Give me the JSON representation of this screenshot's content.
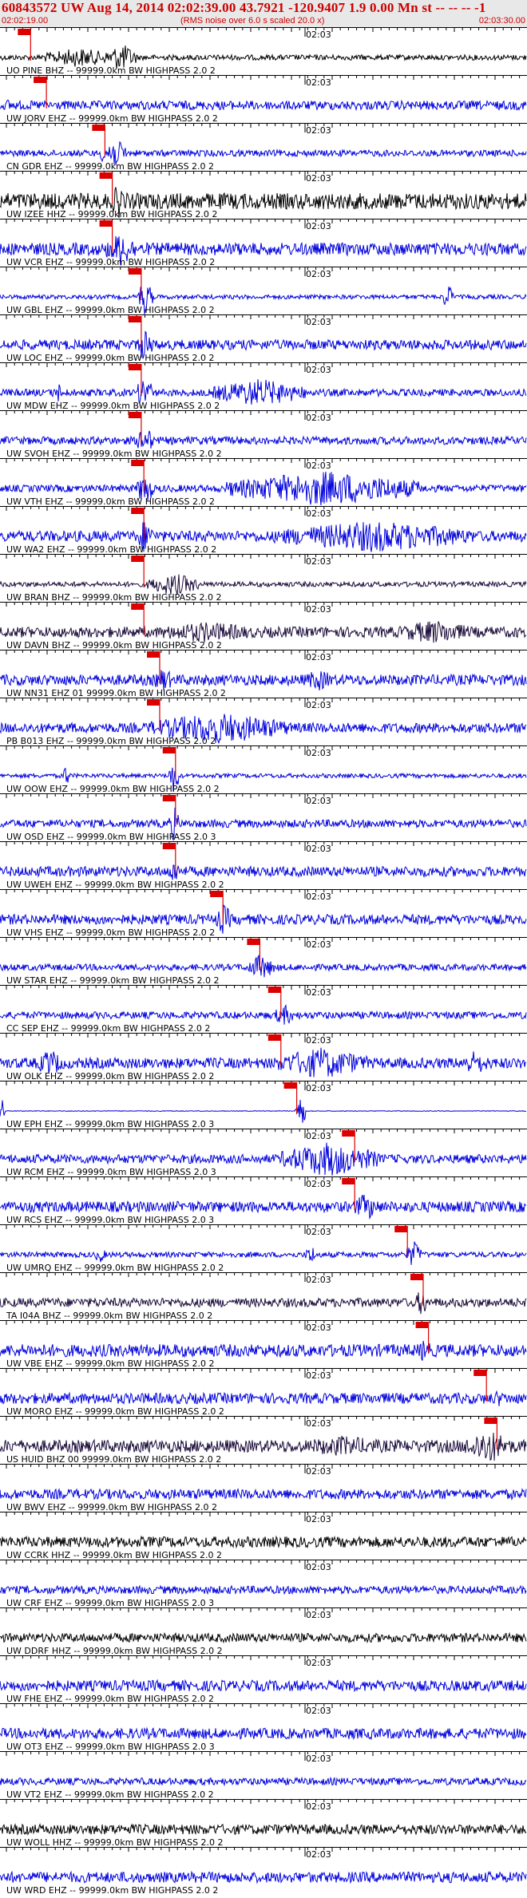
{
  "header": {
    "title": "60843572 UW Aug 14, 2014 02:02:39.00   43.7921 -120.9407  1.9 0.00 Mn st -- -- --  -1",
    "start_time": "02:02:19.00",
    "noise_note": "(RMS noise over 6.0 s scaled 20.0 x)",
    "end_time": "02:03:30.00"
  },
  "minute_label": "02:03",
  "colors": {
    "header_text": "#cc0000",
    "header_bg": "#e8e8e8",
    "pick": "#dd0000",
    "blue_trace": "#0000dd",
    "dark_trace": "#1a0b3a",
    "black_trace": "#000000"
  },
  "channels": [
    {
      "label": "UO PINE BHZ -- 99999.0km BW  HIGHPASS  2.0  2",
      "color": "black",
      "pick": 0.055,
      "noise": 0.15,
      "bursts": [
        [
          0.08,
          0.22,
          0.55
        ],
        [
          0.2,
          0.26,
          0.8
        ]
      ]
    },
    {
      "label": "UW JORV EHZ -- 99999.0km BW  HIGHPASS  2.0  2",
      "color": "blue",
      "pick": 0.085,
      "noise": 0.25,
      "bursts": [
        [
          0.0,
          0.03,
          0.35
        ]
      ]
    },
    {
      "label": "CN GDR EHZ -- 99999.0km BW  HIGHPASS  2.0  2",
      "color": "blue",
      "pick": 0.196,
      "noise": 0.18,
      "bursts": [
        [
          0.19,
          0.24,
          0.9
        ]
      ]
    },
    {
      "label": "UW IZEE HHZ -- 99999.0km BW  HIGHPASS  2.0  2",
      "color": "black",
      "pick": 0.21,
      "noise": 0.45,
      "bursts": [
        [
          0.21,
          0.24,
          1.0
        ]
      ]
    },
    {
      "label": "UW VCR EHZ -- 99999.0km BW  HIGHPASS  2.0  2",
      "color": "blue",
      "pick": 0.21,
      "noise": 0.35,
      "bursts": [
        [
          0.2,
          0.26,
          1.0
        ]
      ]
    },
    {
      "label": "UW GBL EHZ -- 99999.0km BW  HIGHPASS  2.0  2",
      "color": "blue",
      "pick": 0.265,
      "noise": 0.12,
      "bursts": [
        [
          0.26,
          0.29,
          1.0
        ],
        [
          0.84,
          0.86,
          0.8
        ]
      ]
    },
    {
      "label": "UW LOC EHZ -- 99999.0km BW  HIGHPASS  2.0  2",
      "color": "blue",
      "pick": 0.265,
      "noise": 0.28,
      "bursts": [
        [
          0.26,
          0.29,
          1.0
        ]
      ]
    },
    {
      "label": "UW MDW EHZ -- 99999.0km BW  HIGHPASS  2.0  2",
      "color": "blue",
      "pick": 0.265,
      "noise": 0.2,
      "bursts": [
        [
          0.1,
          0.12,
          0.6
        ],
        [
          0.26,
          0.29,
          1.0
        ],
        [
          0.4,
          0.58,
          0.8
        ]
      ]
    },
    {
      "label": "UW SVOH EHZ -- 99999.0km BW  HIGHPASS  2.0  2",
      "color": "blue",
      "pick": 0.265,
      "noise": 0.22,
      "bursts": [
        [
          0.26,
          0.29,
          0.9
        ]
      ]
    },
    {
      "label": "UW VTH EHZ -- 99999.0km BW  HIGHPASS  2.0  2",
      "color": "blue",
      "pick": 0.27,
      "noise": 0.2,
      "bursts": [
        [
          0.26,
          0.29,
          1.0
        ],
        [
          0.43,
          0.8,
          1.0
        ]
      ]
    },
    {
      "label": "UW WA2 EHZ -- 99999.0km BW  HIGHPASS  2.0  2",
      "color": "blue",
      "pick": 0.27,
      "noise": 0.3,
      "bursts": [
        [
          0.26,
          0.29,
          1.0
        ],
        [
          0.52,
          0.9,
          0.9
        ]
      ]
    },
    {
      "label": "UW BRAN BHZ -- 99999.0km BW  HIGHPASS  2.0  2",
      "color": "dark",
      "pick": 0.27,
      "noise": 0.14,
      "bursts": [
        [
          0.28,
          0.38,
          0.65
        ]
      ]
    },
    {
      "label": "UW DAVN BHZ -- 99999.0km BW  HIGHPASS  2.0  2",
      "color": "dark",
      "pick": 0.27,
      "noise": 0.3,
      "bursts": [
        [
          0.28,
          0.5,
          0.6
        ],
        [
          0.75,
          0.9,
          0.7
        ]
      ]
    },
    {
      "label": "UW NN31 EHZ 01 99999.0km BW  HIGHPASS  2.0  2",
      "color": "blue",
      "pick": 0.3,
      "noise": 0.3,
      "bursts": [
        [
          0.29,
          0.33,
          0.7
        ],
        [
          0.57,
          0.64,
          0.6
        ]
      ]
    },
    {
      "label": "PB B013 EHZ -- 99999.0km BW  HIGHPASS  2.0  2",
      "color": "blue",
      "pick": 0.3,
      "noise": 0.28,
      "bursts": [
        [
          0.28,
          0.55,
          0.9
        ]
      ]
    },
    {
      "label": "UW OOW EHZ -- 99999.0km BW  HIGHPASS  2.0  2",
      "color": "blue",
      "pick": 0.33,
      "noise": 0.12,
      "bursts": [
        [
          0.32,
          0.34,
          1.0
        ],
        [
          0.12,
          0.13,
          0.9
        ]
      ]
    },
    {
      "label": "UW OSD EHZ -- 99999.0km BW  HIGHPASS  2.0  3",
      "color": "blue",
      "pick": 0.33,
      "noise": 0.22,
      "bursts": [
        [
          0.32,
          0.34,
          1.0
        ]
      ]
    },
    {
      "label": "UW UWEH EHZ -- 99999.0km BW  HIGHPASS  2.0  2",
      "color": "blue",
      "pick": 0.33,
      "noise": 0.28,
      "bursts": [
        [
          0.32,
          0.34,
          0.8
        ]
      ]
    },
    {
      "label": "UW VHS EHZ -- 99999.0km BW  HIGHPASS  2.0  2",
      "color": "blue",
      "pick": 0.42,
      "noise": 0.28,
      "bursts": [
        [
          0.41,
          0.44,
          0.9
        ]
      ]
    },
    {
      "label": "UW STAR EHZ -- 99999.0km BW  HIGHPASS  2.0  2",
      "color": "blue",
      "pick": 0.49,
      "noise": 0.18,
      "bursts": [
        [
          0.47,
          0.52,
          0.75
        ]
      ]
    },
    {
      "label": "CC SEP EHZ -- 99999.0km BW  HIGHPASS  2.0  2",
      "color": "blue",
      "pick": 0.53,
      "noise": 0.2,
      "bursts": [
        [
          0.52,
          0.56,
          0.6
        ]
      ]
    },
    {
      "label": "UW OLK EHZ -- 99999.0km BW  HIGHPASS  2.0  2",
      "color": "blue",
      "pick": 0.53,
      "noise": 0.3,
      "bursts": [
        [
          0.07,
          0.12,
          0.8
        ],
        [
          0.52,
          0.7,
          0.9
        ],
        [
          0.87,
          0.93,
          0.7
        ]
      ]
    },
    {
      "label": "UW EPH EHZ -- 99999.0km BW  HIGHPASS  2.0  3",
      "color": "blue",
      "pick": 0.56,
      "noise": 0.02,
      "bursts": [
        [
          0.56,
          0.58,
          1.0
        ],
        [
          0.0,
          0.01,
          0.9
        ]
      ]
    },
    {
      "label": "UW RCM EHZ -- 99999.0km BW  HIGHPASS  2.0  3",
      "color": "blue",
      "pick": 0.67,
      "noise": 0.25,
      "bursts": [
        [
          0.53,
          0.72,
          1.0
        ]
      ]
    },
    {
      "label": "UW RCS EHZ -- 99999.0km BW  HIGHPASS  2.0  3",
      "color": "blue",
      "pick": 0.67,
      "noise": 0.3,
      "bursts": [
        [
          0.67,
          0.72,
          0.8
        ]
      ]
    },
    {
      "label": "UW UMRQ EHZ -- 99999.0km BW  HIGHPASS  2.0  2",
      "color": "blue",
      "pick": 0.77,
      "noise": 0.15,
      "bursts": [
        [
          0.18,
          0.2,
          0.5
        ],
        [
          0.58,
          0.6,
          0.6
        ],
        [
          0.77,
          0.8,
          0.8
        ]
      ]
    },
    {
      "label": "TA I04A BHZ -- 99999.0km BW  HIGHPASS  2.0  2",
      "color": "dark",
      "pick": 0.8,
      "noise": 0.25,
      "bursts": [
        [
          0.79,
          0.81,
          0.9
        ]
      ]
    },
    {
      "label": "UW VBE EHZ -- 99999.0km BW  HIGHPASS  2.0  2",
      "color": "blue",
      "pick": 0.81,
      "noise": 0.35,
      "bursts": [
        [
          0.79,
          0.82,
          0.7
        ]
      ]
    },
    {
      "label": "UW MORO EHZ -- 99999.0km BW  HIGHPASS  2.0  2",
      "color": "blue",
      "pick": 0.92,
      "noise": 0.3,
      "bursts": [
        [
          0.93,
          0.96,
          0.5
        ]
      ]
    },
    {
      "label": "US HUID BHZ 00 99999.0km BW  HIGHPASS  2.0  2",
      "color": "dark",
      "pick": 0.94,
      "noise": 0.35,
      "bursts": [
        [
          0.55,
          0.75,
          0.6
        ],
        [
          0.88,
          0.97,
          1.0
        ]
      ]
    },
    {
      "label": "UW BWV EHZ -- 99999.0km BW  HIGHPASS  2.0  2",
      "color": "blue",
      "pick": null,
      "noise": 0.28,
      "bursts": []
    },
    {
      "label": "UW CCRK HHZ -- 99999.0km BW  HIGHPASS  2.0  2",
      "color": "black",
      "pick": null,
      "noise": 0.3,
      "bursts": []
    },
    {
      "label": "UW CRF EHZ -- 99999.0km BW  HIGHPASS  2.0  3",
      "color": "blue",
      "pick": null,
      "noise": 0.22,
      "bursts": []
    },
    {
      "label": "UW DDRF HHZ -- 99999.0km BW  HIGHPASS  2.0  2",
      "color": "black",
      "pick": null,
      "noise": 0.25,
      "bursts": []
    },
    {
      "label": "UW FHE EHZ -- 99999.0km BW  HIGHPASS  2.0  2",
      "color": "blue",
      "pick": null,
      "noise": 0.3,
      "bursts": []
    },
    {
      "label": "UW OT3 EHZ -- 99999.0km BW  HIGHPASS  2.0  3",
      "color": "blue",
      "pick": null,
      "noise": 0.3,
      "bursts": []
    },
    {
      "label": "UW VT2 EHZ -- 99999.0km BW  HIGHPASS  2.0  2",
      "color": "blue",
      "pick": null,
      "noise": 0.2,
      "bursts": []
    },
    {
      "label": "UW WOLL HHZ -- 99999.0km BW  HIGHPASS  2.0  2",
      "color": "black",
      "pick": null,
      "noise": 0.28,
      "bursts": []
    },
    {
      "label": "UW WRD EHZ -- 99999.0km BW  HIGHPASS  2.0  2",
      "color": "blue",
      "pick": null,
      "noise": 0.3,
      "bursts": []
    }
  ]
}
